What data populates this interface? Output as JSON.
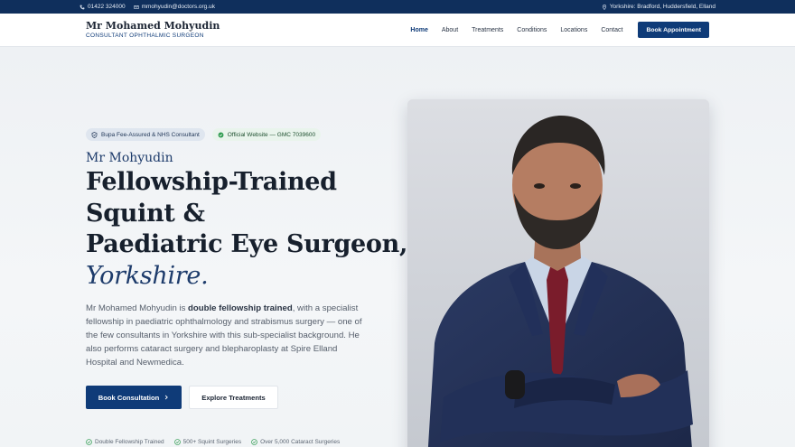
{
  "topbar": {
    "phone": "01422 324000",
    "email": "mmohyudin@doctors.org.uk",
    "locations": "Yorkshire: Bradford, Huddersfield, Elland"
  },
  "header": {
    "brand_name": "Mr Mohamed Mohyudin",
    "brand_sub": "CONSULTANT OPHTHALMIC SURGEON",
    "nav": [
      "Home",
      "About",
      "Treatments",
      "Conditions",
      "Locations",
      "Contact"
    ],
    "cta": "Book Appointment"
  },
  "hero": {
    "badge_bupa": "Bupa Fee-Assured & NHS Consultant",
    "badge_official": "Official Website — GMC 7039600",
    "eyebrow": "Mr Mohyudin",
    "headline_1": "Fellowship-Trained",
    "headline_2": "Squint &",
    "headline_3": "Paediatric Eye Surgeon,",
    "headline_4": "Yorkshire.",
    "desc_pre": "Mr Mohamed Mohyudin is ",
    "desc_bold": "double fellowship trained",
    "desc_post": ", with a specialist fellowship in paediatric ophthalmology and strabismus surgery — one of the few consultants in Yorkshire with this sub-specialist background. He also performs cataract surgery and blepharoplasty at Spire Elland Hospital and Newmedica.",
    "btn_primary": "Book Consultation",
    "btn_secondary": "Explore Treatments",
    "stats": [
      "Double Fellowship Trained",
      "500+ Squint Surgeries",
      "Over 5,000 Cataract Surgeries"
    ]
  },
  "colors": {
    "primary": "#0f3b78",
    "topbar": "#0f2f5c",
    "success": "#2e9b4f"
  },
  "icons": [
    "phone-icon",
    "mail-icon",
    "location-pin-icon",
    "shield-icon",
    "check-circle-icon",
    "chevron-right-icon"
  ]
}
